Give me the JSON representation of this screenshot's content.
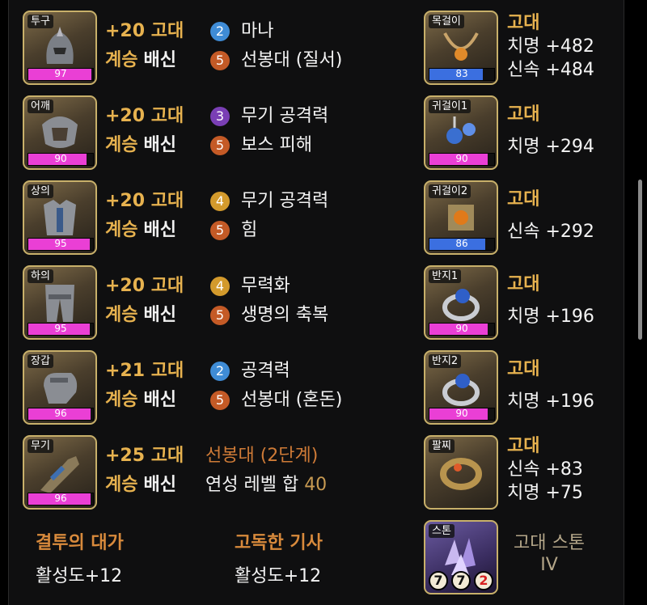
{
  "left_items": [
    {
      "slot": "투구",
      "quality": "97",
      "quality_pct": 97,
      "enhance": "+20",
      "grade": "고대",
      "succession": "계승",
      "set": "배신",
      "engravings": [
        {
          "level": "2",
          "name": "마나",
          "color": "blue"
        },
        {
          "level": "5",
          "name": "선봉대 (질서)",
          "color": "orange"
        }
      ]
    },
    {
      "slot": "어깨",
      "quality": "90",
      "quality_pct": 90,
      "enhance": "+20",
      "grade": "고대",
      "succession": "계승",
      "set": "배신",
      "engravings": [
        {
          "level": "3",
          "name": "무기 공격력",
          "color": "purple"
        },
        {
          "level": "5",
          "name": "보스 피해",
          "color": "orange"
        }
      ]
    },
    {
      "slot": "상의",
      "quality": "95",
      "quality_pct": 95,
      "enhance": "+20",
      "grade": "고대",
      "succession": "계승",
      "set": "배신",
      "engravings": [
        {
          "level": "4",
          "name": "무기 공격력",
          "color": "gold"
        },
        {
          "level": "5",
          "name": "힘",
          "color": "orange"
        }
      ]
    },
    {
      "slot": "하의",
      "quality": "95",
      "quality_pct": 95,
      "enhance": "+20",
      "grade": "고대",
      "succession": "계승",
      "set": "배신",
      "engravings": [
        {
          "level": "4",
          "name": "무력화",
          "color": "gold"
        },
        {
          "level": "5",
          "name": "생명의 축복",
          "color": "orange"
        }
      ]
    },
    {
      "slot": "장갑",
      "quality": "96",
      "quality_pct": 96,
      "enhance": "+21",
      "grade": "고대",
      "succession": "계승",
      "set": "배신",
      "engravings": [
        {
          "level": "2",
          "name": "공격력",
          "color": "blue"
        },
        {
          "level": "5",
          "name": "선봉대 (혼돈)",
          "color": "orange"
        }
      ]
    },
    {
      "slot": "무기",
      "quality": "96",
      "quality_pct": 96,
      "enhance": "+25",
      "grade": "고대",
      "succession": "계승",
      "set": "배신",
      "special": "선봉대 (2단계)",
      "transcend_label": "연성 레벨 합",
      "transcend_value": "40"
    }
  ],
  "right_items": [
    {
      "slot": "목걸이",
      "quality": "83",
      "quality_pct": 83,
      "bar": "blue",
      "grade": "고대",
      "stats": [
        "치명 +482",
        "신속 +484"
      ]
    },
    {
      "slot": "귀걸이1",
      "quality": "90",
      "quality_pct": 90,
      "bar": "pink",
      "grade": "고대",
      "stats": [
        "치명 +294"
      ]
    },
    {
      "slot": "귀걸이2",
      "quality": "86",
      "quality_pct": 86,
      "bar": "blue",
      "grade": "고대",
      "stats": [
        "신속 +292"
      ]
    },
    {
      "slot": "반지1",
      "quality": "90",
      "quality_pct": 90,
      "bar": "pink",
      "grade": "고대",
      "stats": [
        "치명 +196"
      ]
    },
    {
      "slot": "반지2",
      "quality": "90",
      "quality_pct": 90,
      "bar": "pink",
      "grade": "고대",
      "stats": [
        "치명 +196"
      ]
    },
    {
      "slot": "팔찌",
      "quality": "",
      "quality_pct": 0,
      "bar": "none",
      "grade": "고대",
      "stats": [
        "신속 +83",
        "치명 +75"
      ]
    }
  ],
  "stone": {
    "slot": "스톤",
    "title_line1": "고대 스톤",
    "title_line2": "IV",
    "digits": [
      "7",
      "7",
      "2"
    ]
  },
  "set_effects": [
    {
      "name": "결투의 대가",
      "value": "활성도+12"
    },
    {
      "name": "고독한 기사",
      "value": "활성도+12"
    }
  ],
  "colors": {
    "grade_gold": "#e7b24f",
    "orange_text": "#cf7b37",
    "quality_pink": "#ea3fd5",
    "quality_blue": "#3b6fe0"
  },
  "icons": [
    "helmet-icon",
    "shoulder-armor-icon",
    "chest-armor-icon",
    "leg-armor-icon",
    "gauntlet-icon",
    "weapon-icon",
    "necklace-icon",
    "earring-icon",
    "ring-icon",
    "bracelet-icon",
    "ability-stone-icon"
  ]
}
